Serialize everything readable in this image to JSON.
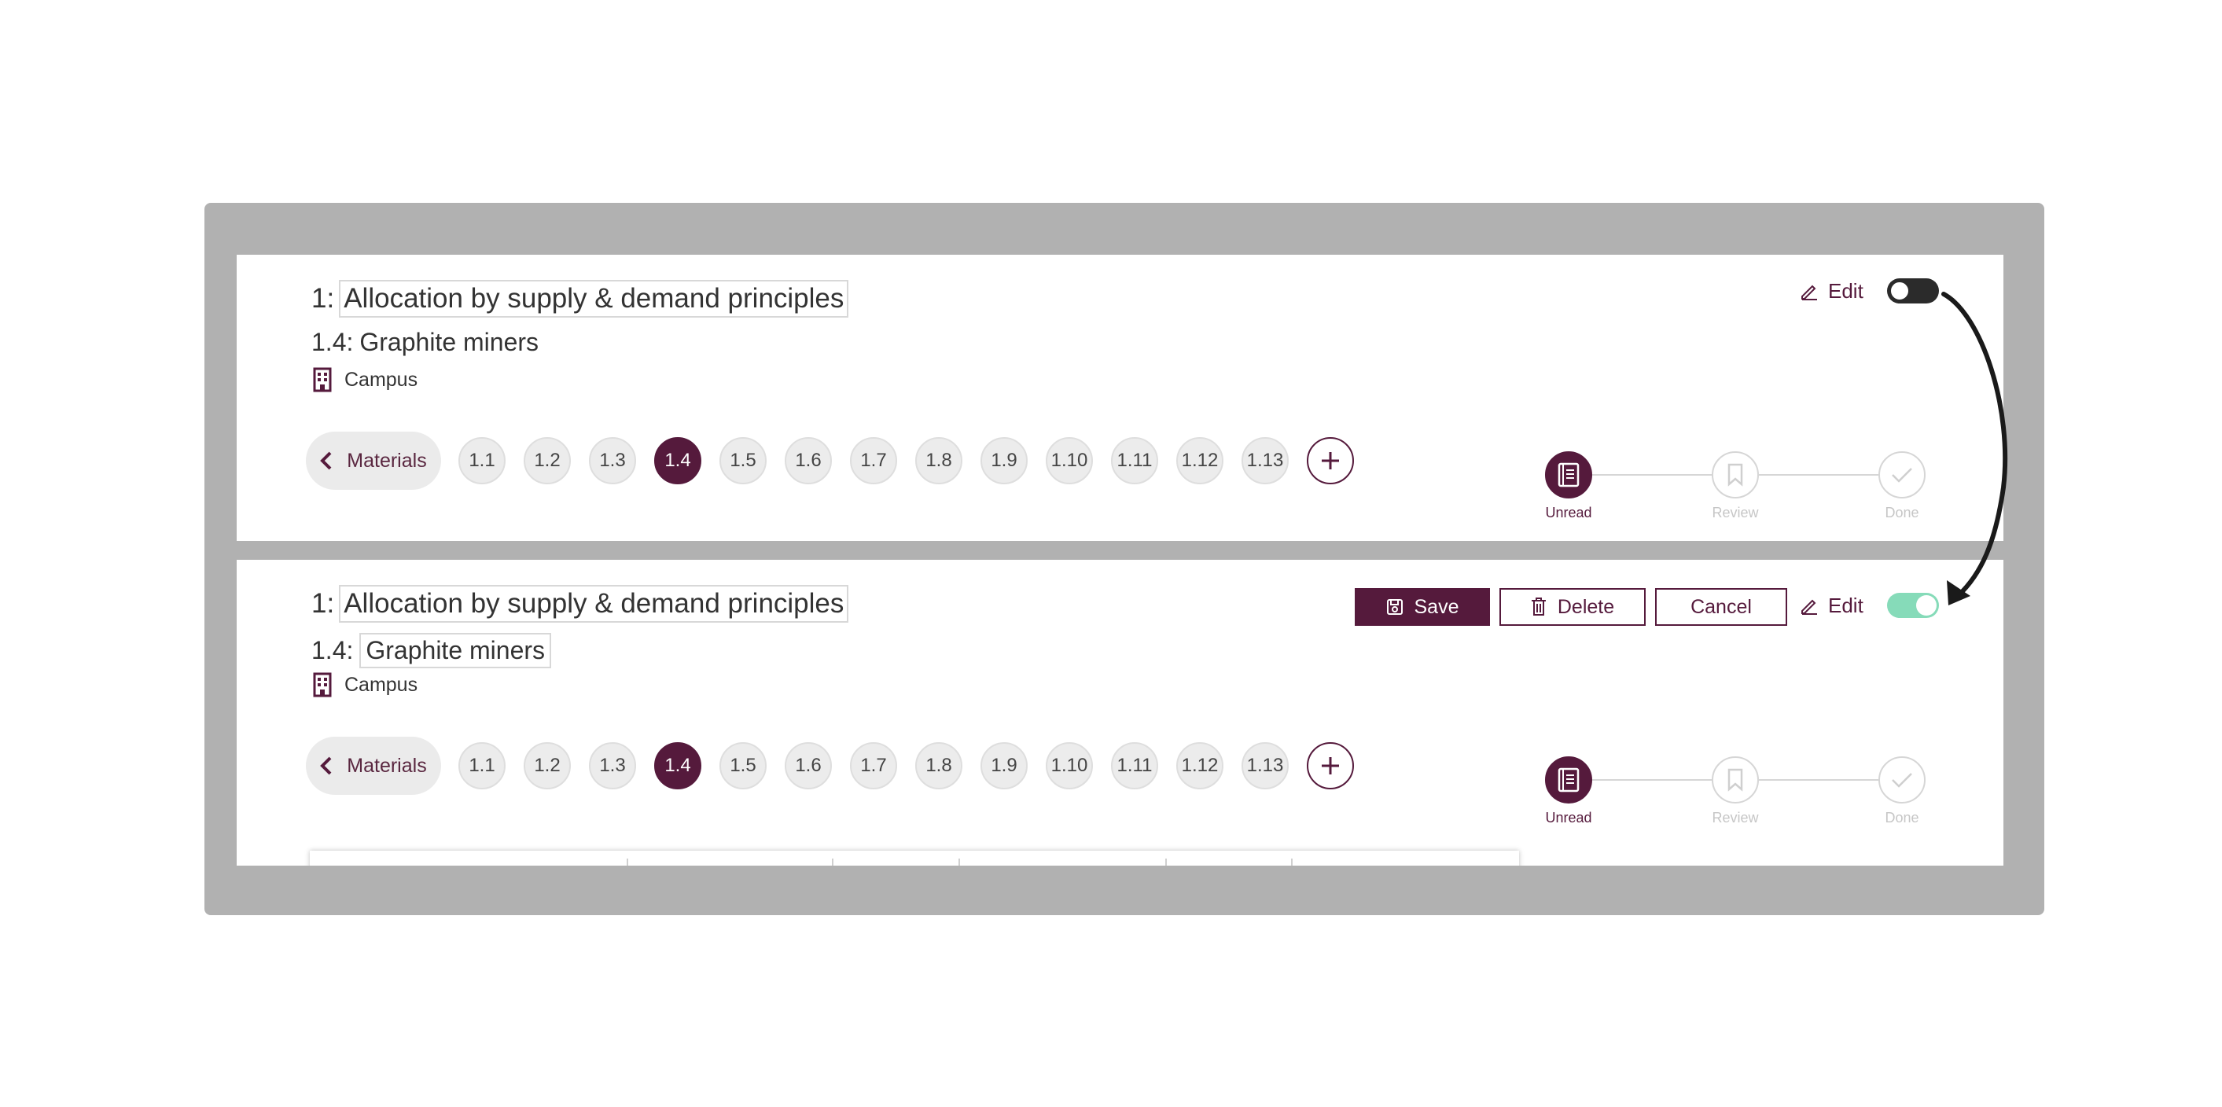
{
  "view_mode": {
    "section": {
      "number": "1:",
      "title": "Allocation by supply & demand principles"
    },
    "subsection": {
      "number": "1.4:",
      "title": "Graphite miners"
    },
    "location": "Campus",
    "materials_label": "Materials",
    "chips": [
      "1.1",
      "1.2",
      "1.3",
      "1.4",
      "1.5",
      "1.6",
      "1.7",
      "1.8",
      "1.9",
      "1.10",
      "1.11",
      "1.12",
      "1.13"
    ],
    "active_chip": "1.4",
    "edit_label": "Edit",
    "edit_enabled": false,
    "status_steps": [
      "Unread",
      "Review",
      "Done"
    ],
    "active_status": "Unread"
  },
  "edit_mode": {
    "section": {
      "number": "1:",
      "title": "Allocation by supply & demand principles"
    },
    "subsection": {
      "number": "1.4:",
      "title": "Graphite miners"
    },
    "location": "Campus",
    "materials_label": "Materials",
    "chips": [
      "1.1",
      "1.2",
      "1.3",
      "1.4",
      "1.5",
      "1.6",
      "1.7",
      "1.8",
      "1.9",
      "1.10",
      "1.11",
      "1.12",
      "1.13"
    ],
    "active_chip": "1.4",
    "buttons": {
      "save": "Save",
      "delete": "Delete",
      "cancel": "Cancel"
    },
    "edit_label": "Edit",
    "edit_enabled": true,
    "status_steps": [
      "Unread",
      "Review",
      "Done"
    ],
    "active_status": "Unread"
  },
  "colors": {
    "primary": "#551a3c",
    "toggle_on": "#86dbb9",
    "toggle_off": "#2b2b2b",
    "frame": "#b1b1b1"
  }
}
